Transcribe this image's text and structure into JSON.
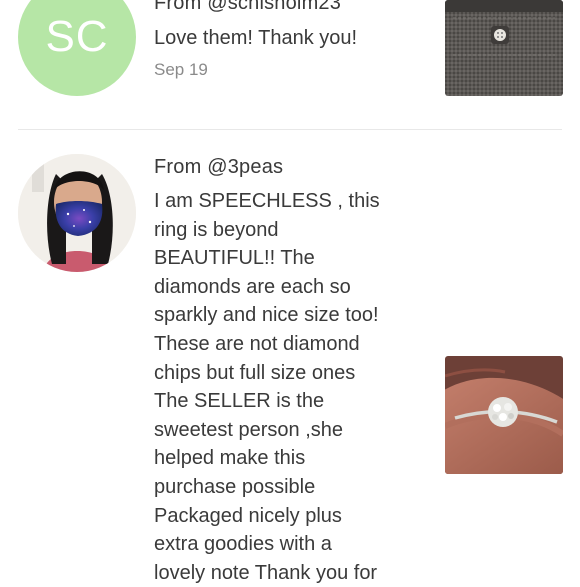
{
  "reviews": [
    {
      "avatar_initials": "SC",
      "from": "From @schisholm23",
      "text": "Love them! Thank you!",
      "date": "Sep 19",
      "colors": {
        "avatar_bg": "#b6e6a6"
      }
    },
    {
      "from": "From @3peas",
      "lines": [
        "I am SPEECHLESS , this",
        "ring is beyond",
        "BEAUTIFUL!! The",
        "diamonds are each so",
        "sparkly and nice size too!",
        "These are not diamond",
        "chips but full size ones",
        "The SELLER is the",
        "sweetest person ,she",
        "helped make this",
        "purchase possible",
        "Packaged nicely plus",
        "extra goodies with a",
        "lovely note Thank you for"
      ]
    }
  ]
}
